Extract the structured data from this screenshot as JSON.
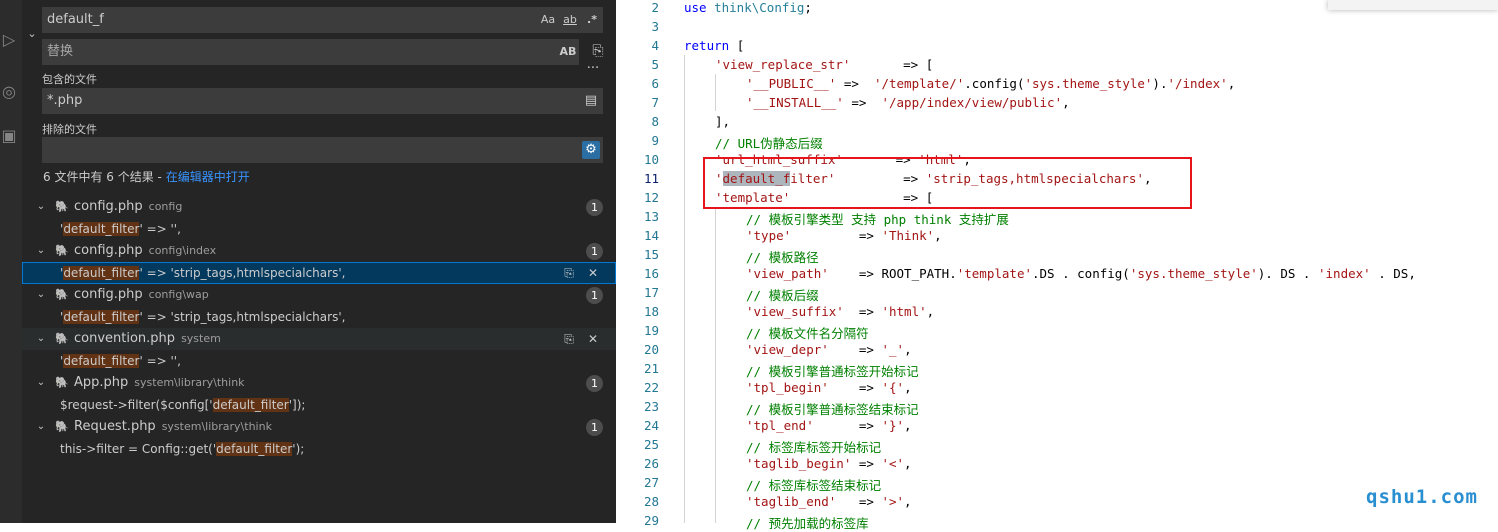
{
  "search": {
    "query": "default_f",
    "opt_case": "Aa",
    "opt_word": "ab",
    "opt_regex": ".*",
    "replace_placeholder": "替换",
    "replace_all_label": "AB",
    "more": "···",
    "include_label": "包含的文件",
    "include_value": "*.php",
    "exclude_label": "排除的文件",
    "exclude_value": "",
    "summary": "6 文件中有 6 个结果 - ",
    "open_in_editor": "在编辑器中打开"
  },
  "results": [
    {
      "file": "config.php",
      "path": "config",
      "count": "1",
      "match_pre": "'",
      "match_hit": "default_filter",
      "match_post": "'          => '',"
    },
    {
      "file": "config.php",
      "path": "config\\index",
      "count": "1",
      "match_pre": "'",
      "match_hit": "default_filter",
      "match_post": "'          => 'strip_tags,htmlspecialchars',"
    },
    {
      "file": "config.php",
      "path": "config\\wap",
      "count": "1",
      "match_pre": "'",
      "match_hit": "default_filter",
      "match_post": "'          => 'strip_tags,htmlspecialchars',"
    },
    {
      "file": "convention.php",
      "path": "system",
      "count": "",
      "match_pre": "'",
      "match_hit": "default_filter",
      "match_post": "'          => '',"
    },
    {
      "file": "App.php",
      "path": "system\\library\\think",
      "count": "1",
      "match_pre": "$request->filter($config['",
      "match_hit": "default_filter",
      "match_post": "']);"
    },
    {
      "file": "Request.php",
      "path": "system\\library\\think",
      "count": "1",
      "match_pre": "this->filter = Config::get('",
      "match_hit": "default_filter",
      "match_post": "');"
    }
  ],
  "editor": {
    "line_numbers": [
      "2",
      "3",
      "4",
      "5",
      "6",
      "7",
      "8",
      "9",
      "10",
      "11",
      "12",
      "13",
      "14",
      "15",
      "16",
      "17",
      "18",
      "19",
      "20",
      "21",
      "22",
      "23",
      "24",
      "25",
      "26",
      "27",
      "28",
      "29"
    ],
    "lines": {
      "l2_kw": "use ",
      "l2_ns": "think\\Config",
      "l2_end": ";",
      "l4_kw": "return ",
      "l4_b": "[",
      "l5_k": "'view_replace_str'",
      "l5_op": "       => ",
      "l5_b": "[",
      "l6_k": "'__PUBLIC__'",
      "l6_op": " =>  ",
      "l6_s1": "'/template/'",
      "l6_m": ".config(",
      "l6_s2": "'sys.theme_style'",
      "l6_m2": ").",
      "l6_s3": "'/index'",
      "l6_e": ",",
      "l7_k": "'__INSTALL__'",
      "l7_op": " =>  ",
      "l7_s": "'/app/index/view/public'",
      "l7_e": ",",
      "l8": "],",
      "l9": "// URL伪静态后缀",
      "l10_k": "'url_html_suffix'",
      "l10_op": "       => ",
      "l10_s": "'html'",
      "l10_e": ",",
      "l11_q": "'",
      "l11_w": "default_f",
      "l11_r": "ilter'",
      "l11_op": "         => ",
      "l11_s": "'strip_tags,htmlspecialchars'",
      "l11_e": ",",
      "l12_k": "'template'",
      "l12_op": "               => ",
      "l12_b": "[",
      "l13": "// 模板引擎类型 支持 php think 支持扩展",
      "l14_k": "'type'",
      "l14_op": "         => ",
      "l14_s": "'Think'",
      "l14_e": ",",
      "l15": "// 模板路径",
      "l16_k": "'view_path'",
      "l16_op": "    => ROOT_PATH.",
      "l16_s1": "'template'",
      "l16_m": ".DS . config(",
      "l16_s2": "'sys.theme_style'",
      "l16_m2": "). DS . ",
      "l16_s3": "'index'",
      "l16_e": " . DS,",
      "l17": "// 模板后缀",
      "l18_k": "'view_suffix'",
      "l18_op": "  => ",
      "l18_s": "'html'",
      "l18_e": ",",
      "l19": "// 模板文件名分隔符",
      "l20_k": "'view_depr'",
      "l20_op": "    => ",
      "l20_s": "'_'",
      "l20_e": ",",
      "l21": "// 模板引擎普通标签开始标记",
      "l22_k": "'tpl_begin'",
      "l22_op": "    => ",
      "l22_s": "'{'",
      "l22_e": ",",
      "l23": "// 模板引擎普通标签结束标记",
      "l24_k": "'tpl_end'",
      "l24_op": "      => ",
      "l24_s": "'}'",
      "l24_e": ",",
      "l25": "// 标签库标签开始标记",
      "l26_k": "'taglib_begin'",
      "l26_op": " => ",
      "l26_s": "'<'",
      "l26_e": ",",
      "l27": "// 标签库标签结束标记",
      "l28_k": "'taglib_end'",
      "l28_op": "   => ",
      "l28_s": "'>'",
      "l28_e": ",",
      "l29": "// 预先加载的标签库"
    }
  },
  "watermark": "qshu1.com",
  "colors": {
    "accent": "#3794ff",
    "highlight_box": "#e8141c",
    "match_bg": "#613214",
    "selected_row": "#04395e"
  }
}
